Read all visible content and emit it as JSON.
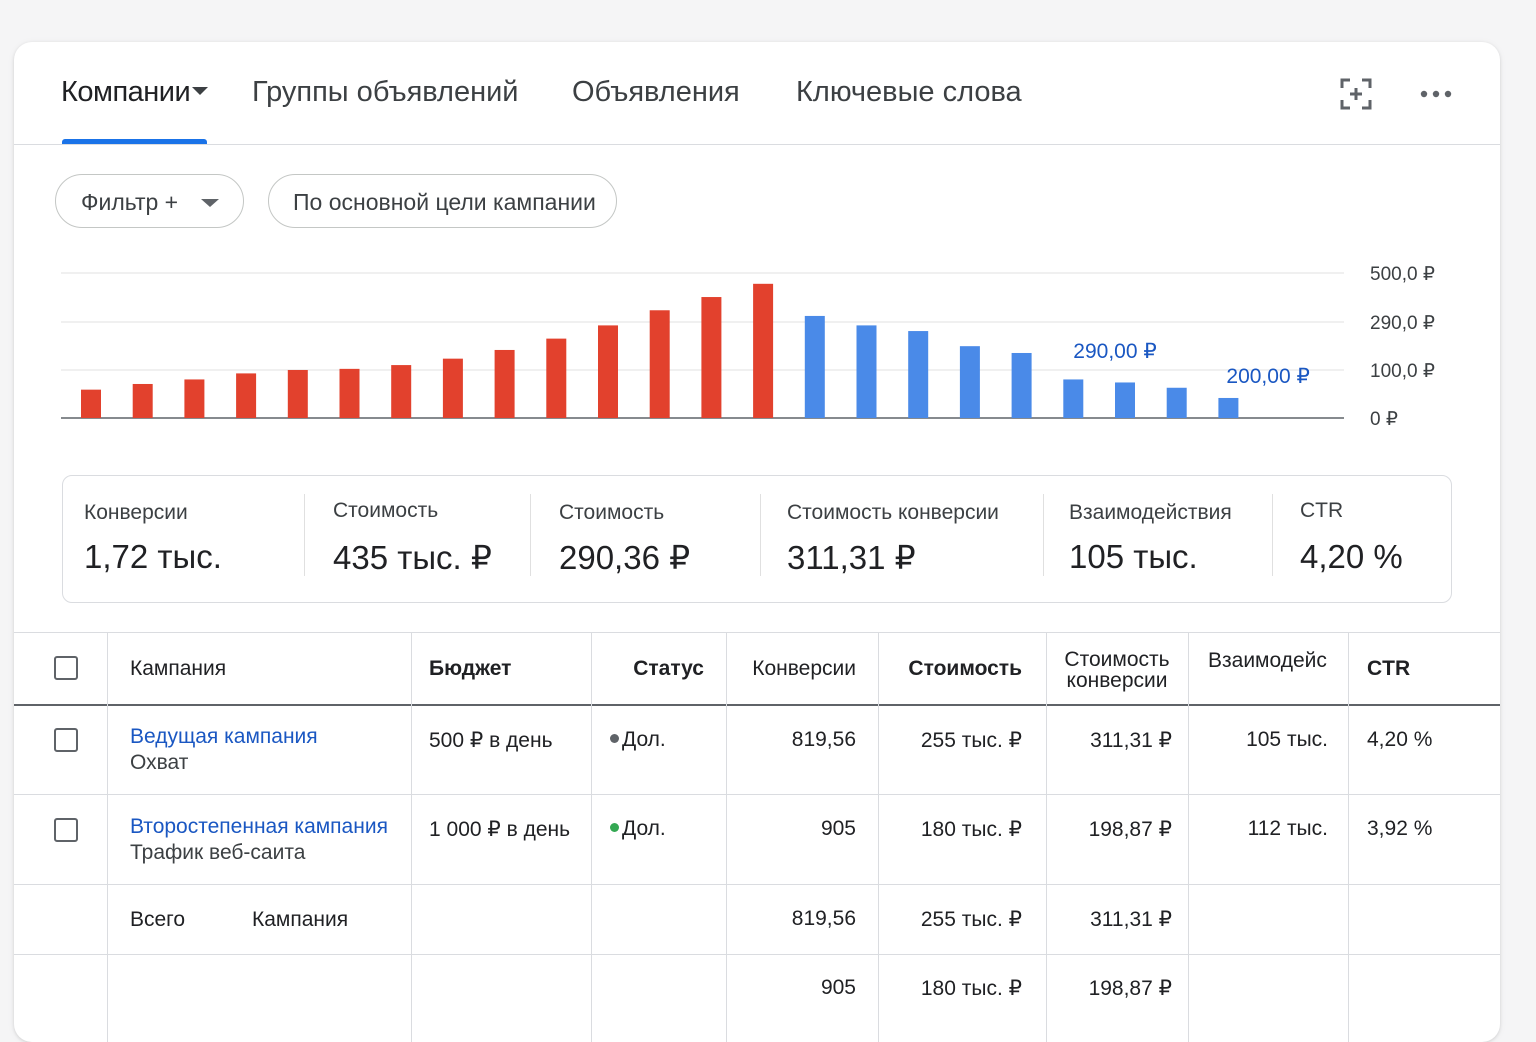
{
  "tabs": [
    {
      "label": "Компании",
      "active": true
    },
    {
      "label": "Группы объявлений"
    },
    {
      "label": "Объявления"
    },
    {
      "label": "Ключевые слова"
    }
  ],
  "toolbar_icons": [
    "expand-icon",
    "more-options-icon"
  ],
  "filters": {
    "filter_label": "Фильтр +",
    "goal_label": "По основной цели кампании"
  },
  "colors": {
    "accent": "#1a73e8",
    "red_bar": "#e2412d",
    "blue_bar": "#4a8ae8",
    "link": "#1a57c2",
    "status_gray": "#5f6368",
    "status_green": "#34a853"
  },
  "chart_data": {
    "type": "bar",
    "y_tick_labels": [
      "500,0 ₽",
      "290,0 ₽",
      "100,0 ₽",
      "0 ₽"
    ],
    "values": [
      75,
      90,
      102,
      118,
      127,
      130,
      140,
      157,
      180,
      210,
      245,
      285,
      320,
      355,
      270,
      245,
      230,
      190,
      172,
      102,
      94,
      80,
      53
    ],
    "colors": [
      "red",
      "red",
      "red",
      "red",
      "red",
      "red",
      "red",
      "red",
      "red",
      "red",
      "red",
      "red",
      "red",
      "red",
      "blue",
      "blue",
      "blue",
      "blue",
      "blue",
      "blue",
      "blue",
      "blue",
      "blue"
    ],
    "annotations": [
      {
        "text": "290,00 ₽",
        "bar_index": 19
      },
      {
        "text": "200,00 ₽",
        "bar_index": 22
      }
    ],
    "grid": true
  },
  "metrics": [
    {
      "label": "Конверсии",
      "value": "1,72 тыс."
    },
    {
      "label": "Стоимость",
      "value": "435 тыс. ₽"
    },
    {
      "label": "Стоимость",
      "value": "290,36 ₽"
    },
    {
      "label": "Стоимость конверсии",
      "value": "311,31 ₽"
    },
    {
      "label": "Взаимодействия",
      "value": "105 тыс."
    },
    {
      "label": "CTR",
      "value": "4,20 %"
    }
  ],
  "table": {
    "headers": {
      "campaign": "Кампания",
      "budget": "Бюджет",
      "status": "Статус",
      "conversions": "Конверсии",
      "cost": "Стоимость",
      "cost_conv_1": "Стоимость",
      "cost_conv_2": "конверсии",
      "interactions": "Взаимодейс",
      "ctr": "CTR"
    },
    "rows": [
      {
        "name": "Ведущая кампания",
        "type": "Охват",
        "budget": "500 ₽ в день",
        "status": "Дол.",
        "status_color": "#5f6368",
        "conversions": "819,56",
        "cost": "255 тыс. ₽",
        "cost_conv": "311,31 ₽",
        "interactions": "105 тыс.",
        "ctr": "4,20 %"
      },
      {
        "name": "Второстепенная кампания",
        "type": "Трафик веб-саита",
        "budget": "1 000 ₽ в день",
        "status": "Дол.",
        "status_color": "#34a853",
        "conversions": "905",
        "cost": "180 тыс. ₽",
        "cost_conv": "198,87 ₽",
        "interactions": "112 тыс.",
        "ctr": "3,92 %"
      }
    ],
    "totals": [
      {
        "label": "Всего",
        "label2": "Кампания",
        "conversions": "819,56",
        "cost": "255 тыс. ₽",
        "cost_conv": "311,31 ₽"
      },
      {
        "label": "",
        "label2": "",
        "conversions": "905",
        "cost": "180 тыс. ₽",
        "cost_conv": "198,87 ₽"
      }
    ]
  }
}
